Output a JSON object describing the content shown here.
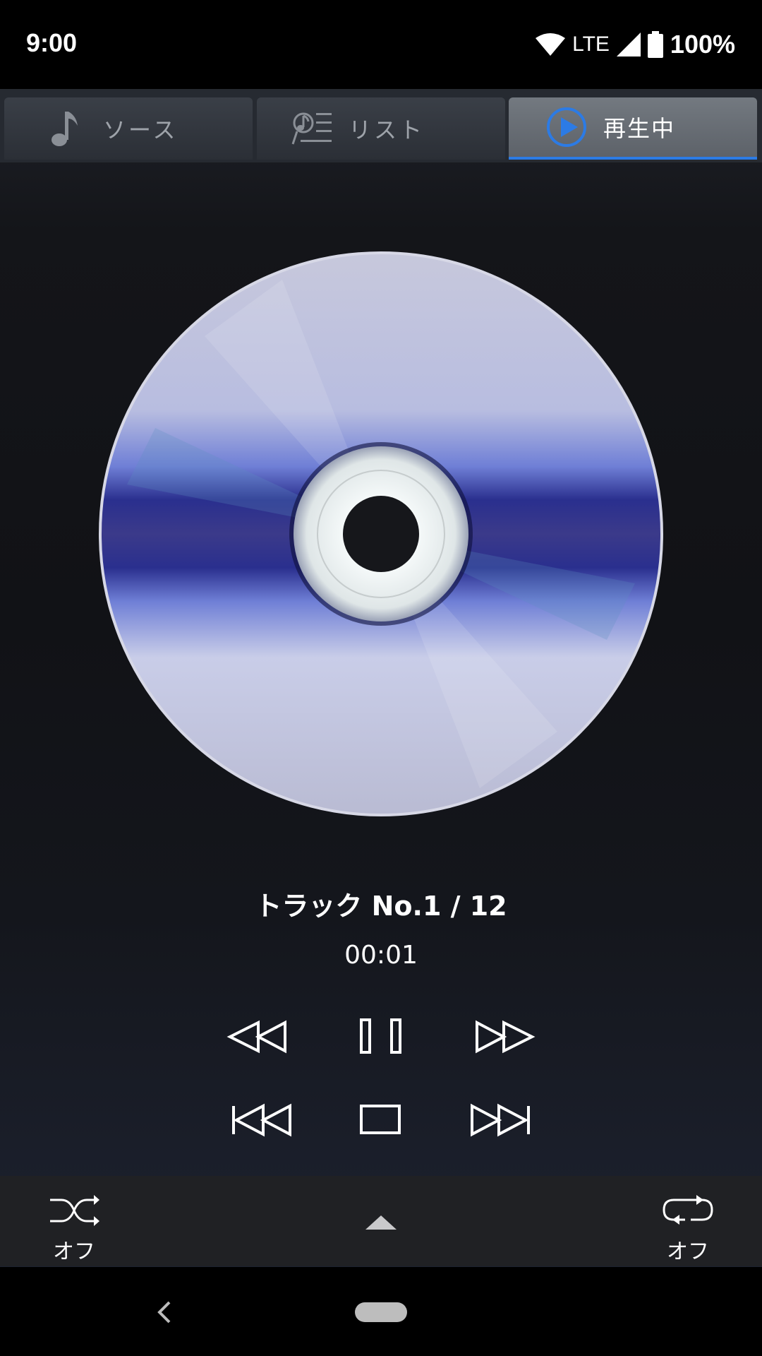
{
  "status_bar": {
    "time": "9:00",
    "network": "LTE",
    "battery": "100%",
    "icons": [
      "wifi-icon",
      "cell-signal-icon",
      "battery-icon"
    ]
  },
  "tabs": [
    {
      "label": "ソース",
      "icon": "music-note-icon",
      "selected": false
    },
    {
      "label": "リスト",
      "icon": "playlist-icon",
      "selected": false
    },
    {
      "label": "再生中",
      "icon": "play-circle-icon",
      "selected": true
    }
  ],
  "now_playing": {
    "artwork": "cd-disc-icon",
    "track": "トラック No.1 / 12",
    "elapsed": "00:01"
  },
  "controls": {
    "row1": [
      "rewind-icon",
      "pause-icon",
      "fast-forward-icon"
    ],
    "row2": [
      "previous-track-icon",
      "stop-icon",
      "next-track-icon"
    ]
  },
  "bottom_bar": {
    "shuffle_label": "オフ",
    "repeat_label": "オフ",
    "expand_icon": "chevron-up-icon"
  },
  "nav_bar": {
    "back_icon": "back-icon",
    "home_icon": "home-pill-icon"
  },
  "colors": {
    "accent": "#2c7be5",
    "background": "#141519"
  }
}
